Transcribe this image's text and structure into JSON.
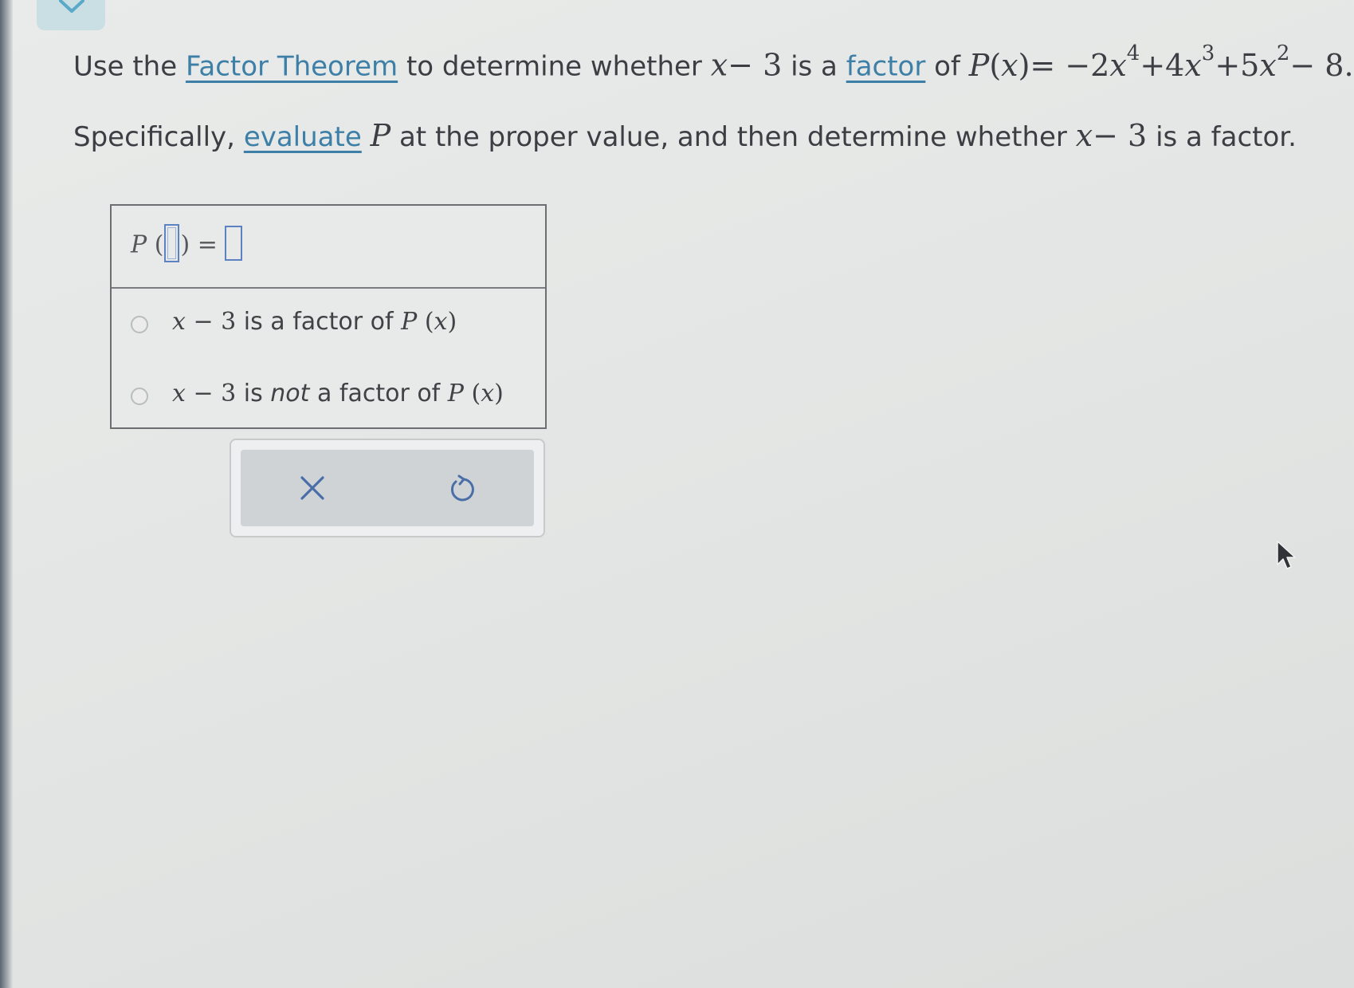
{
  "question": {
    "line1": {
      "prefix": "Use the",
      "link_factor_theorem": "Factor Theorem",
      "mid": "to determine whether",
      "expr_x": "x",
      "expr_rest": "− 3",
      "is_a": "is a",
      "link_factor": "factor",
      "of": "of",
      "formula": {
        "p": "P",
        "lparen": "(",
        "x": "x",
        "rparen": ")",
        "eq": "= −2",
        "x1": "x",
        "exp4": "4",
        "plus4": "+4",
        "x2": "x",
        "exp3": "3",
        "plus5": "+5",
        "x3": "x",
        "exp2": "2",
        "tail": "− 8."
      }
    },
    "line2": {
      "prefix": "Specifically,",
      "link_evaluate": "evaluate",
      "p": "P",
      "mid": "at the proper value, and then determine whether",
      "expr_x": "x",
      "expr_rest": "− 3",
      "suffix": "is a factor."
    }
  },
  "answer": {
    "p_label": "P",
    "lparen": "(",
    "rparen": ")",
    "equals": "=",
    "x_value": "",
    "p_value": "",
    "options": [
      {
        "x": "x",
        "minus3": "− 3",
        "text": "is a factor of",
        "p": "P",
        "lp": "(",
        "px": "x",
        "rp": ")",
        "selected": false
      },
      {
        "x": "x",
        "minus3": "− 3",
        "text_pre": "is",
        "text_em": "not",
        "text_post": "a factor of",
        "p": "P",
        "lp": "(",
        "px": "x",
        "rp": ")",
        "selected": false
      }
    ]
  },
  "buttons": {
    "clear_icon": "x-icon",
    "undo_icon": "undo-icon"
  },
  "colors": {
    "link": "#3d7fa6",
    "input_border": "#5c82c2",
    "tab": "#c9dfe4"
  }
}
